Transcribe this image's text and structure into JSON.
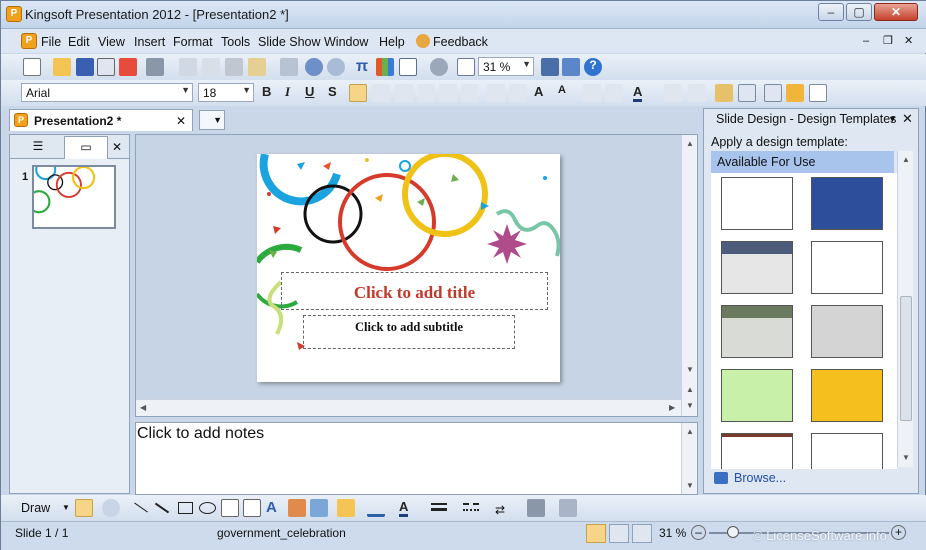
{
  "window": {
    "title": "Kingsoft Presentation 2012 - [Presentation2 *]",
    "min": "–",
    "max": "▢",
    "close": "✕"
  },
  "menu": [
    {
      "label": "File",
      "u": "F",
      "rest": "ile"
    },
    {
      "label": "Edit",
      "u": "E",
      "rest": "dit"
    },
    {
      "label": "View",
      "u": "V",
      "rest": "iew"
    },
    {
      "label": "Insert",
      "u": "I",
      "rest": "nsert"
    },
    {
      "label": "Format",
      "u": "F",
      "rest": "ormat"
    },
    {
      "label": "Tools",
      "u": "T",
      "rest": "ools"
    },
    {
      "label": "Slide Show",
      "u": "",
      "rest": "Slide Show"
    },
    {
      "label": "Window",
      "u": "W",
      "rest": "indow"
    },
    {
      "label": "Help",
      "u": "H",
      "rest": "elp"
    },
    {
      "label": "Feedback",
      "u": "",
      "rest": "Feedback"
    }
  ],
  "menu_right": {
    "min": "–",
    "restore": "❐",
    "close": "✕"
  },
  "toolbar": {
    "zoom": "31 %",
    "font": "Arial",
    "size": "18"
  },
  "document_tab": {
    "label": "Presentation2 *",
    "close": "✕"
  },
  "thumb_panel": {
    "slide_number": "1",
    "close": "✕"
  },
  "slide": {
    "title": "Click to add title",
    "subtitle": "Click to add subtitle"
  },
  "notes": {
    "placeholder": "Click to add notes"
  },
  "task_pane": {
    "title": "Slide Design - Design Templates",
    "apply_label": "Apply a design template:",
    "section": "Available For Use",
    "browse": "Browse...",
    "close": "✕"
  },
  "draw_toolbar": {
    "draw": "Draw"
  },
  "status": {
    "slide": "Slide 1 / 1",
    "template": "government_celebration",
    "zoom": "31 %",
    "watermark": "© LicenseSoftware.info"
  },
  "colors": {
    "title_red": "#c0392b",
    "accent_blue": "#2f5fa8",
    "section_bg": "#a9c4ec"
  }
}
